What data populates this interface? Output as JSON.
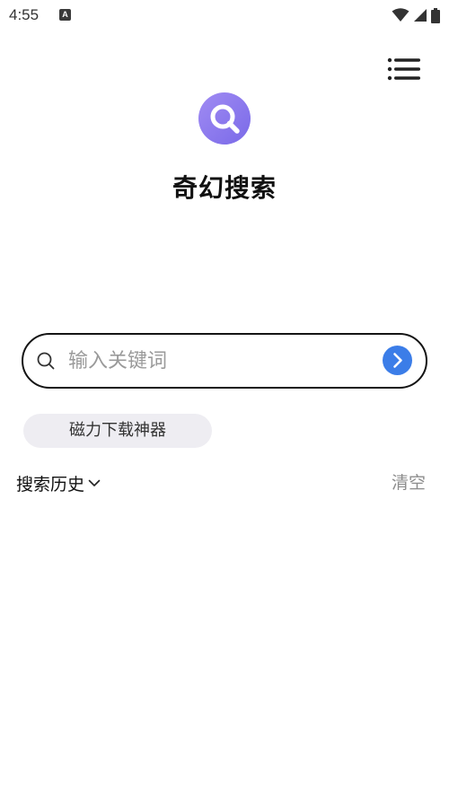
{
  "status_bar": {
    "time": "4:55",
    "app_icon": "A"
  },
  "colors": {
    "accent": "#3b7de8",
    "logo": "#8f7cf0",
    "tag_background": "#eeedf2"
  },
  "header": {
    "title": "奇幻搜索"
  },
  "search": {
    "placeholder": "输入关键词",
    "value": ""
  },
  "quick_tags": [
    {
      "label": "磁力下载神器"
    }
  ],
  "history": {
    "title": "搜索历史",
    "clear_label": "清空"
  }
}
